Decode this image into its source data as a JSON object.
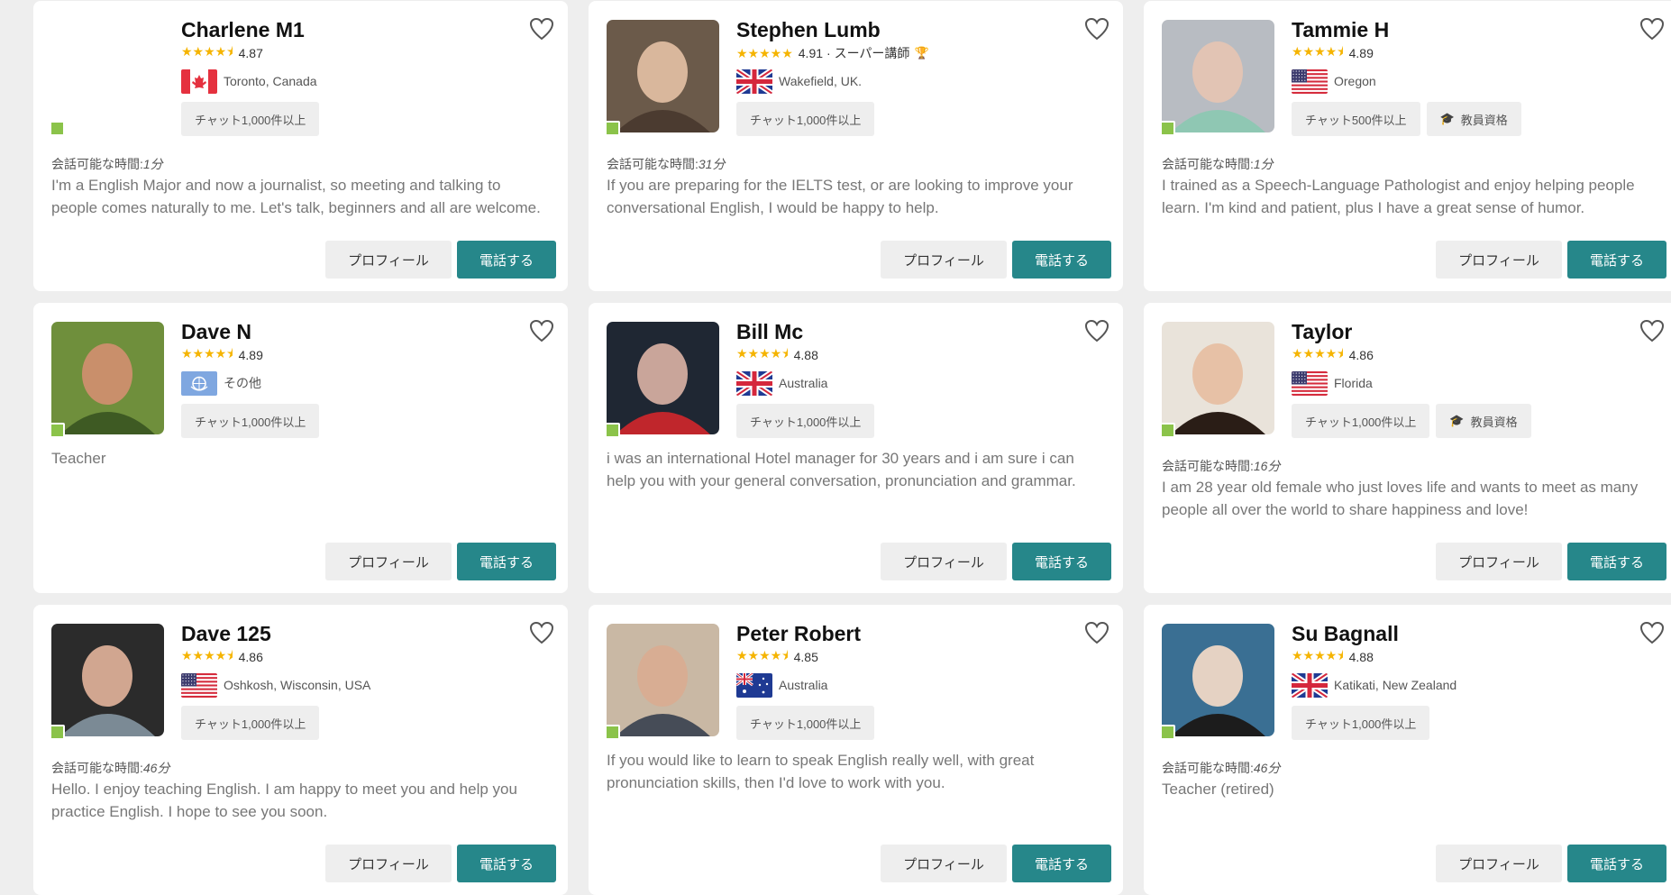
{
  "colors": {
    "accent": "#26878a",
    "star": "#f5b400",
    "online": "#8bc34a",
    "badge_bg": "#eeeeee"
  },
  "labels": {
    "profile_button": "プロフィール",
    "call_button": "電話する",
    "availability_prefix": "会話可能な時間:"
  },
  "tutors": [
    {
      "name": "Charlene M1",
      "rating": "4.87",
      "rating_extra": "",
      "location": "Toronto, Canada",
      "flag": "canada-flag-icon",
      "avatar": "blank",
      "badges": [
        "チャット1,000件以上"
      ],
      "availability": "1分",
      "description": "I'm a English Major and now a journalist, so meeting and talking to people comes naturally to me. Let's talk, beginners and all are welcome."
    },
    {
      "name": "Stephen Lumb",
      "rating": "4.91",
      "rating_extra": "· スーパー講師",
      "location": "Wakefield, UK.",
      "flag": "uk-flag-icon",
      "avatar": "photo",
      "badges": [
        "チャット1,000件以上"
      ],
      "availability": "31分",
      "description": "If you are preparing for the IELTS test, or are looking to improve your conversational English, I would be happy to help."
    },
    {
      "name": "Tammie H",
      "rating": "4.89",
      "rating_extra": "",
      "location": "Oregon",
      "flag": "us-flag-icon",
      "avatar": "photo",
      "badges": [
        "チャット500件以上",
        "教員資格"
      ],
      "availability": "1分",
      "description": "I trained as a Speech-Language Pathologist and enjoy helping people learn. I'm kind and patient, plus I have a great sense of humor."
    },
    {
      "name": "Dave N",
      "rating": "4.89",
      "rating_extra": "",
      "location": "その他",
      "flag": "un-flag-icon",
      "avatar": "photo",
      "badges": [
        "チャット1,000件以上"
      ],
      "availability": "",
      "description": "Teacher"
    },
    {
      "name": "Bill Mc",
      "rating": "4.88",
      "rating_extra": "",
      "location": "Australia",
      "flag": "uk-flag-icon",
      "avatar": "photo",
      "badges": [
        "チャット1,000件以上"
      ],
      "availability": "",
      "description": "i was an international Hotel manager for 30 years and i am sure i can help you with your general conversation, pronunciation and grammar."
    },
    {
      "name": "Taylor",
      "rating": "4.86",
      "rating_extra": "",
      "location": "Florida",
      "flag": "us-flag-icon",
      "avatar": "photo",
      "badges": [
        "チャット1,000件以上",
        "教員資格"
      ],
      "availability": "16分",
      "description": "I am 28 year old female who just loves life and wants to meet as many people all over the world to share happiness and love!"
    },
    {
      "name": "Dave 125",
      "rating": "4.86",
      "rating_extra": "",
      "location": "Oshkosh, Wisconsin, USA",
      "flag": "us-flag-icon",
      "avatar": "photo",
      "badges": [
        "チャット1,000件以上"
      ],
      "availability": "46分",
      "description": "Hello. I enjoy teaching English. I am happy to meet you and help you practice English. I hope to see you soon."
    },
    {
      "name": "Peter Robert",
      "rating": "4.85",
      "rating_extra": "",
      "location": "Australia",
      "flag": "australia-flag-icon",
      "avatar": "photo",
      "badges": [
        "チャット1,000件以上"
      ],
      "availability": "",
      "description": "If you would like to learn to speak English really well, with great pronunciation skills, then I'd love to work with you."
    },
    {
      "name": "Su Bagnall",
      "rating": "4.88",
      "rating_extra": "",
      "location": "Katikati, New Zealand",
      "flag": "uk-flag-icon",
      "avatar": "photo",
      "badges": [
        "チャット1,000件以上"
      ],
      "availability": "46分",
      "description": "Teacher (retired)"
    }
  ]
}
